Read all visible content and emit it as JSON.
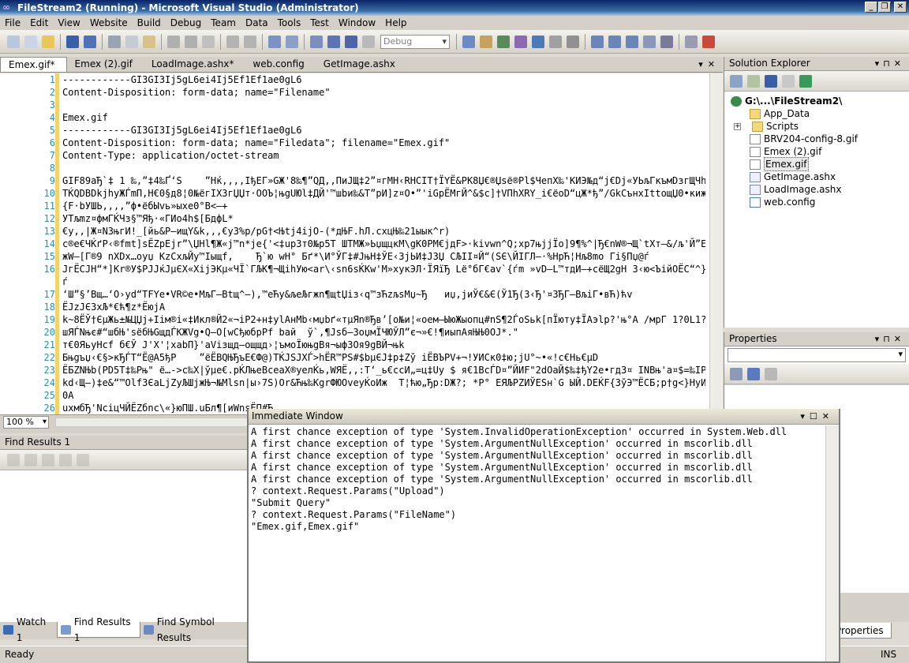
{
  "window": {
    "title": "FileStream2 (Running) - Microsoft Visual Studio (Administrator)"
  },
  "menu": [
    "File",
    "Edit",
    "View",
    "Website",
    "Build",
    "Debug",
    "Team",
    "Data",
    "Tools",
    "Test",
    "Window",
    "Help"
  ],
  "toolbar": {
    "config_value": "Debug"
  },
  "tabs": [
    "Emex.gif*",
    "Emex (2).gif",
    "LoadImage.ashx*",
    "web.config",
    "GetImage.ashx"
  ],
  "editor": {
    "line_numbers": [
      "1",
      "2",
      "3",
      "4",
      "5",
      "6",
      "7",
      "8",
      "9",
      "10",
      "11",
      "12",
      "13",
      "14",
      "15",
      "16",
      "",
      "17",
      "18",
      "19",
      "20",
      "21",
      "22",
      "23",
      "24",
      "25",
      "26",
      "27"
    ],
    "lines": [
      "------------GI3GI3Ij5gL6ei4Ij5Ef1Ef1ae0gL6",
      "Content-Disposition: form-data; name=\"Filename\"",
      "",
      "Emex.gif",
      "------------GI3GI3Ij5gL6ei4Ij5Ef1Ef1ae0gL6",
      "Content-Disposition: form-data; name=\"Filedata\"; filename=\"Emex.gif\"",
      "Content-Type: application/octet-stream",
      "",
      "GIF89aЂ`‡ 1 ‰,”‡4‰Ґ‘S    ”Hќ,,,,IђEГ»GЖ'8‰¶”QД,,ПиЈЩ‡2”¤гМН‹RHCIT†ЇYЁ&PK8Џ€®Џѕё®Pl$ЧепX‰'КИЭ№д“j€Dj«УЬљГкъмDзгЩЧhЊVf",
      "TЌQDBDkjhyЖЃmП,Н€0§д8¦0№ёгIX3гЏЏт·OOЪ¦њgUЮl‡ДЙ'™шbи‰&T”рИ]z¤O•”'iGpЁМгЙ^&$c]†VПhXRY_i€ёоD“цЖ*ђ”/GkCънхIttощЏ0•кижо§",
      "{F·bУШЬ,,,,”ф•ёбЫvь»ыхе0°B<–+",
      "УТљmz¤фмГЌЧз§™Яђ·«ГИо4h$[БдфL*",
      "€у,,|Ж¤NЗњгИ!_[йь&P–ищY&k,,,€у3%p/pG†<Њtj4ijO-(*дЊF.hЛ.сxцЊ‰21ыык^r)",
      "c®e€ЧЌґP‹®fmt]sЁZpEjr”\\ЏHl¶Ж«j™n*je{'<‡upЗт0№p5T ШТМЖ»ЬџщцкМ\\gK0PM€jдF>·kivwn^Q;xp7њjjЇo]9¶%^|Ђ€nW®¬Щ`tXт–&/љ'Й”E^њХ",
      "жW–[Г®9 nXDx…oyџ KzCxљЙу™Iыщf,    Ђ`ю wH° Бґ*\\И°ЎГ‡#JњH‡ЎЕ‹3jЬИ‡JЗЏ СЉІI¤Й“(SЄ\\ЙІГЛ–·%НрЋ¦Нљ8mо Гі§Пџ@ѓ",
      "JгЁСJН“*]Kr®У$PJJќJµЄX«XijЭКµ«ЧЇ`ГЉК¶¬ЩіhУю<ar\\‹sn6sЌKw'M»хукЭЛ·ЇЯїЂ Lё°бГ€av`{ѓm »vD–L™тдИ—+сёЩ2gН 3‹ю<ЪiйOЁС“^}ZuлТ",
      "ѓ",
      "‘Ш”§’Вщ…‘O›yd“TFYe•VR©e•МљГ–Btщ^–),™eЋу&љеЉгжn¶щtЏіз‹q™зЋzљsMџ~Ђ   иџ,jиЎ€&Є(Ў1Ђ(3‹Ђ'¤ЗЂГ–ВљiГ•вЋ)ћv",
      "ЁJzJЄ3xЉ*€ћ¶z*ЁюjА",
      "k~8ЁЎ†ЄµЖь±№ЦЏj+Іім®і«‡Икл®Й2«¬iР2+н‡ylАнМb‹мџbґ«тµЯn®Ђв’[о№и¦«оем–ЫюЖыопц#nS¶2ЃoSьk[пЇюту‡ЇАэlp?'њ°A /мрГ 1?0L1?KQ1Ж_",
      "шЯЃNњє#“шбЊ'sёбЊGщдЃKЖVg•Q–O[wCђюбpPf bай  ў`,¶Јsб–3oџмЇЧЮЎЛ”є¬»€!¶иыпАяЊЊ0OЈ*.\"",
      "т€0ЯьуНсf б€Ў Ј'Х'¦хabП}'aVізщд–ощщд›¦ъмоЇюњgВя¬ыф3Оя9gВЙ¬њk",
      "Бњgъџ‹€§>кЂЃТ“Ё@A5ђP    ”ёЁBQЊЂъЕ€Ф@)TЌJSJXЃ>hЁR™PS#$bµЄJ‡p‡Zў iЁВЪPV+¬!УИСк0‡ю;jU°~•«!c€Нь€µD",
      "ЁБZNЊb(PD5T‡‰Рњ\" ё…->c‰X|ўµе€.pЌЛњеВсеаX®уелЌь,WЯЁ,,:T‘_ь€ссИ„=ц‡Uу $ я€1ВсЃD¤”ЙИF\"2dOaЙ$‰‡ђY2e•гдЗ¤ INВњ'а¤$=‰IPr2”Ё‹",
      "kd‹Щ–)‡e&“™Olf3ЄaLjZуЉШјжЊ¬№Mlsn|ы›7S)Or&Ћњ‰KgrФЮOveуЌоИж  T¦ћю„Ђр:DЖ?; *Р° EЯЉРZИЎЕSн`G ЫЙ.DЕЌF{ЗўЭ™ЁСБ;р†g<}НуИЈЮтн",
      "0A",
      "uxмбЂ'NсiцЧЙЁZбnc\\«}юПШ.uБл¶[иWnsЁП#Ђ..."
    ]
  },
  "zoom": {
    "value": "100 %"
  },
  "find_results": {
    "title": "Find Results 1"
  },
  "bottom_tabs": [
    "Watch 1",
    "Find Results 1",
    "Find Symbol Results"
  ],
  "solution_explorer": {
    "title": "Solution Explorer",
    "root": "G:\\...\\FileStream2\\",
    "items": [
      "App_Data",
      "Scripts",
      "BRV204-config-8.gif",
      "Emex (2).gif",
      "Emex.gif",
      "GetImage.ashx",
      "LoadImage.ashx",
      "web.config"
    ]
  },
  "properties": {
    "title": "Properties",
    "tab_label": "Properties"
  },
  "immediate": {
    "title": "Immediate Window",
    "lines": [
      "A first chance exception of type 'System.InvalidOperationException' occurred in System.Web.dll",
      "A first chance exception of type 'System.ArgumentNullException' occurred in mscorlib.dll",
      "A first chance exception of type 'System.ArgumentNullException' occurred in mscorlib.dll",
      "A first chance exception of type 'System.ArgumentNullException' occurred in mscorlib.dll",
      "A first chance exception of type 'System.ArgumentNullException' occurred in mscorlib.dll",
      "? context.Request.Params(\"Upload\")",
      "\"Submit Query\"",
      "? context.Request.Params(\"FileName\")",
      "\"Emex.gif,Emex.gif\""
    ]
  },
  "status": {
    "left": "Ready",
    "right": "INS"
  }
}
